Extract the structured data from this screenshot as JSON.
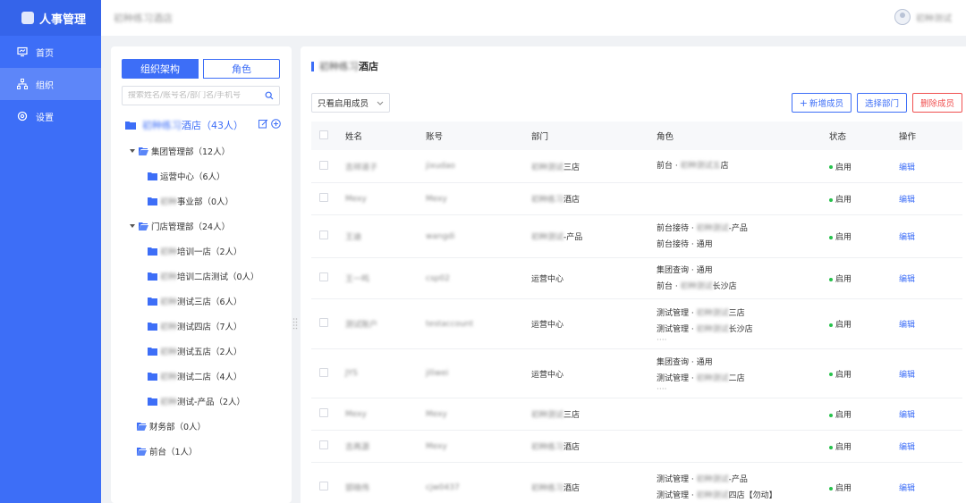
{
  "app": {
    "brand": "人事管理",
    "header_title": "初种练习酒店",
    "user_name": "初种测试"
  },
  "nav": [
    {
      "label": "首页",
      "icon": "dashboard-icon"
    },
    {
      "label": "组织",
      "icon": "org-icon"
    },
    {
      "label": "设置",
      "icon": "gear-icon"
    }
  ],
  "tree": {
    "tabs": [
      "组织架构",
      "角色"
    ],
    "search_placeholder": "搜索姓名/账号名/部门名/手机号",
    "root": {
      "blur": "初种练习",
      "label": "酒店（43人）"
    },
    "nodes": [
      {
        "blur": "",
        "label": "集团管理部（12人）"
      },
      {
        "blur": "",
        "label": "运营中心（6人）"
      },
      {
        "blur": "初种",
        "label": "事业部（0人）"
      },
      {
        "blur": "",
        "label": "门店管理部（24人）"
      },
      {
        "blur": "初种",
        "label": "培训一店（2人）"
      },
      {
        "blur": "初种",
        "label": "培训二店测试（0人）"
      },
      {
        "blur": "初种",
        "label": "测试三店（6人）"
      },
      {
        "blur": "初种",
        "label": "测试四店（7人）"
      },
      {
        "blur": "初种",
        "label": "测试五店（2人）"
      },
      {
        "blur": "初种",
        "label": "测试二店（4人）"
      },
      {
        "blur": "初种",
        "label": "测试-产品（2人）"
      },
      {
        "blur": "",
        "label": "财务部（0人）"
      },
      {
        "blur": "",
        "label": "前台（1人）"
      }
    ]
  },
  "main": {
    "title_blur": "初种练习",
    "title": "酒店",
    "filter": "只看启用成员",
    "buttons": {
      "add": "新增成员",
      "select_dept": "选择部门",
      "delete": "删除成员"
    },
    "columns": [
      "姓名",
      "账号",
      "部门",
      "角色",
      "状态",
      "操作"
    ],
    "rows": [
      {
        "name": "吉祥道子",
        "account": "jixudao",
        "dept_blur": "初种测试",
        "dept": "三店",
        "roles": [
          {
            "a": "前台 · ",
            "b": "初种测试五",
            "c": "店"
          }
        ],
        "more": false,
        "status": "启用",
        "op": "编辑"
      },
      {
        "name": "Mexy",
        "account": "Mexy",
        "dept_blur": "初种练习",
        "dept": "酒店",
        "roles": [],
        "more": false,
        "status": "启用",
        "op": "编辑"
      },
      {
        "name": "王迪",
        "account": "wangdi",
        "dept_blur": "初种测试",
        "dept": "-产品",
        "roles": [
          {
            "a": "前台接待 · ",
            "b": "初种测试",
            "c": "-产品"
          },
          {
            "a": "前台接待 · 通用",
            "b": "",
            "c": ""
          }
        ],
        "more": false,
        "status": "启用",
        "op": "编辑"
      },
      {
        "name": "王一鸣",
        "account": "csp02",
        "dept_blur": "",
        "dept": "运营中心",
        "roles": [
          {
            "a": "集团查询 · 通用",
            "b": "",
            "c": ""
          },
          {
            "a": "前台 · ",
            "b": "初种测试",
            "c": "长沙店"
          }
        ],
        "more": false,
        "status": "启用",
        "op": "编辑"
      },
      {
        "name": "测试账户",
        "account": "testaccount",
        "dept_blur": "",
        "dept": "运营中心",
        "roles": [
          {
            "a": "测试管理 · ",
            "b": "初种测试",
            "c": "三店"
          },
          {
            "a": "测试管理 · ",
            "b": "初种测试",
            "c": "长沙店"
          }
        ],
        "more": true,
        "status": "启用",
        "op": "编辑"
      },
      {
        "name": "JYS",
        "account": "jiliwei",
        "dept_blur": "",
        "dept": "运营中心",
        "roles": [
          {
            "a": "集团查询 · 通用",
            "b": "",
            "c": ""
          },
          {
            "a": "测试管理 · ",
            "b": "初种测试",
            "c": "二店"
          }
        ],
        "more": true,
        "status": "启用",
        "op": "编辑"
      },
      {
        "name": "Mexy",
        "account": "Mexy",
        "dept_blur": "初种测试",
        "dept": "三店",
        "roles": [],
        "more": false,
        "status": "启用",
        "op": "编辑"
      },
      {
        "name": "吉再源",
        "account": "Mexy",
        "dept_blur": "初种练习",
        "dept": "酒店",
        "roles": [],
        "more": false,
        "status": "启用",
        "op": "编辑"
      },
      {
        "name": "郭晓伟",
        "account": "cjw0437",
        "dept_blur": "初种练习",
        "dept": "酒店",
        "roles": [
          {
            "a": "测试管理 · ",
            "b": "初种测试",
            "c": "-产品"
          },
          {
            "a": "测试管理 · ",
            "b": "初种测试",
            "c": "四店【勿动】"
          }
        ],
        "more": false,
        "status": "启用",
        "op": "编辑"
      }
    ]
  },
  "colors": {
    "primary": "#3d6ef7",
    "danger": "#f05050",
    "status": "#27c24c"
  }
}
